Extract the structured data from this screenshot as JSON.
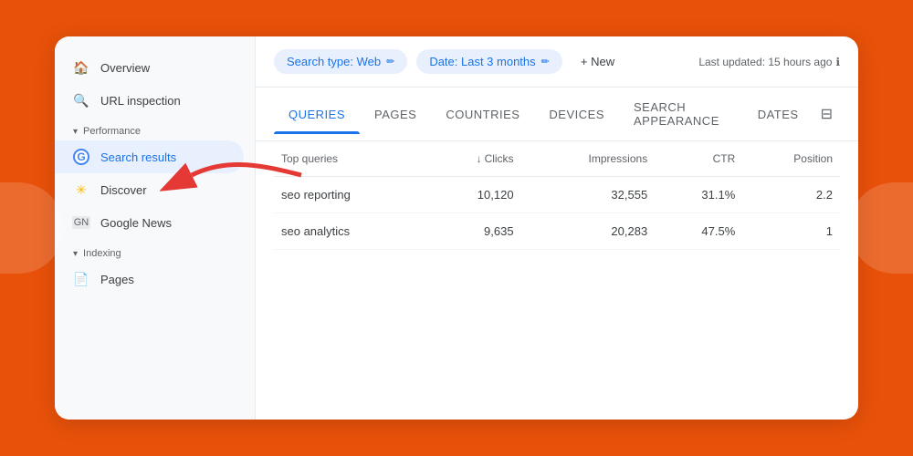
{
  "background_color": "#e8510a",
  "sidebar": {
    "items": [
      {
        "id": "overview",
        "label": "Overview",
        "icon": "home"
      },
      {
        "id": "url-inspection",
        "label": "URL inspection",
        "icon": "search"
      }
    ],
    "sections": [
      {
        "id": "performance",
        "label": "Performance",
        "items": [
          {
            "id": "search-results",
            "label": "Search results",
            "icon": "g",
            "active": true
          },
          {
            "id": "discover",
            "label": "Discover",
            "icon": "asterisk"
          },
          {
            "id": "google-news",
            "label": "Google News",
            "icon": "news"
          }
        ]
      },
      {
        "id": "indexing",
        "label": "Indexing",
        "items": [
          {
            "id": "pages",
            "label": "Pages",
            "icon": "pages"
          }
        ]
      }
    ]
  },
  "toolbar": {
    "search_type_label": "Search type: Web",
    "date_label": "Date: Last 3 months",
    "new_button_label": "+ New",
    "last_updated": "Last updated: 15 hours ago"
  },
  "tabs": [
    {
      "id": "queries",
      "label": "QUERIES",
      "active": true
    },
    {
      "id": "pages",
      "label": "PAGES",
      "active": false
    },
    {
      "id": "countries",
      "label": "COUNTRIES",
      "active": false
    },
    {
      "id": "devices",
      "label": "DEVICES",
      "active": false
    },
    {
      "id": "search-appearance",
      "label": "SEARCH APPEARANCE",
      "active": false
    },
    {
      "id": "dates",
      "label": "DATES",
      "active": false
    }
  ],
  "table": {
    "header": {
      "query_col": "Top queries",
      "clicks_col": "Clicks",
      "impressions_col": "Impressions",
      "ctr_col": "CTR",
      "position_col": "Position"
    },
    "rows": [
      {
        "query": "seo reporting",
        "clicks": "10,120",
        "impressions": "32,555",
        "ctr": "31.1%",
        "position": "2.2"
      },
      {
        "query": "seo analytics",
        "clicks": "9,635",
        "impressions": "20,283",
        "ctr": "47.5%",
        "position": "1"
      }
    ]
  }
}
